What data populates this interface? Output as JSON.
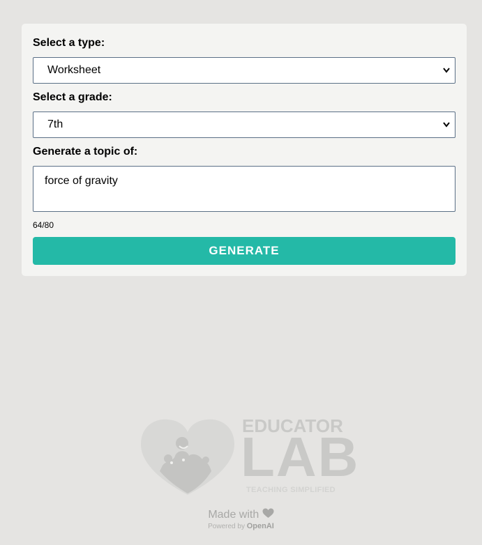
{
  "form": {
    "type_label": "Select a type:",
    "type_value": "Worksheet",
    "grade_label": "Select a grade:",
    "grade_value": "7th",
    "topic_label": "Generate a topic of:",
    "topic_value": "force of gravity",
    "char_counter": "64/80",
    "generate_label": "GENERATE"
  },
  "logo": {
    "line1": "EDUCATOR",
    "line2": "LAB",
    "tagline": "TEACHING SIMPLIFIED"
  },
  "footer": {
    "made_with": "Made with",
    "powered_by": "Powered by",
    "brand": "OpenAI"
  },
  "colors": {
    "background": "#e5e4e2",
    "card": "#f4f4f2",
    "accent": "#24b9a7",
    "logo_gray": "#c9c9c7"
  },
  "icons": {
    "select_chevron": "chevron-down-icon",
    "heart": "heart-icon",
    "logo_mark": "heart-puzzle-logo-icon"
  }
}
